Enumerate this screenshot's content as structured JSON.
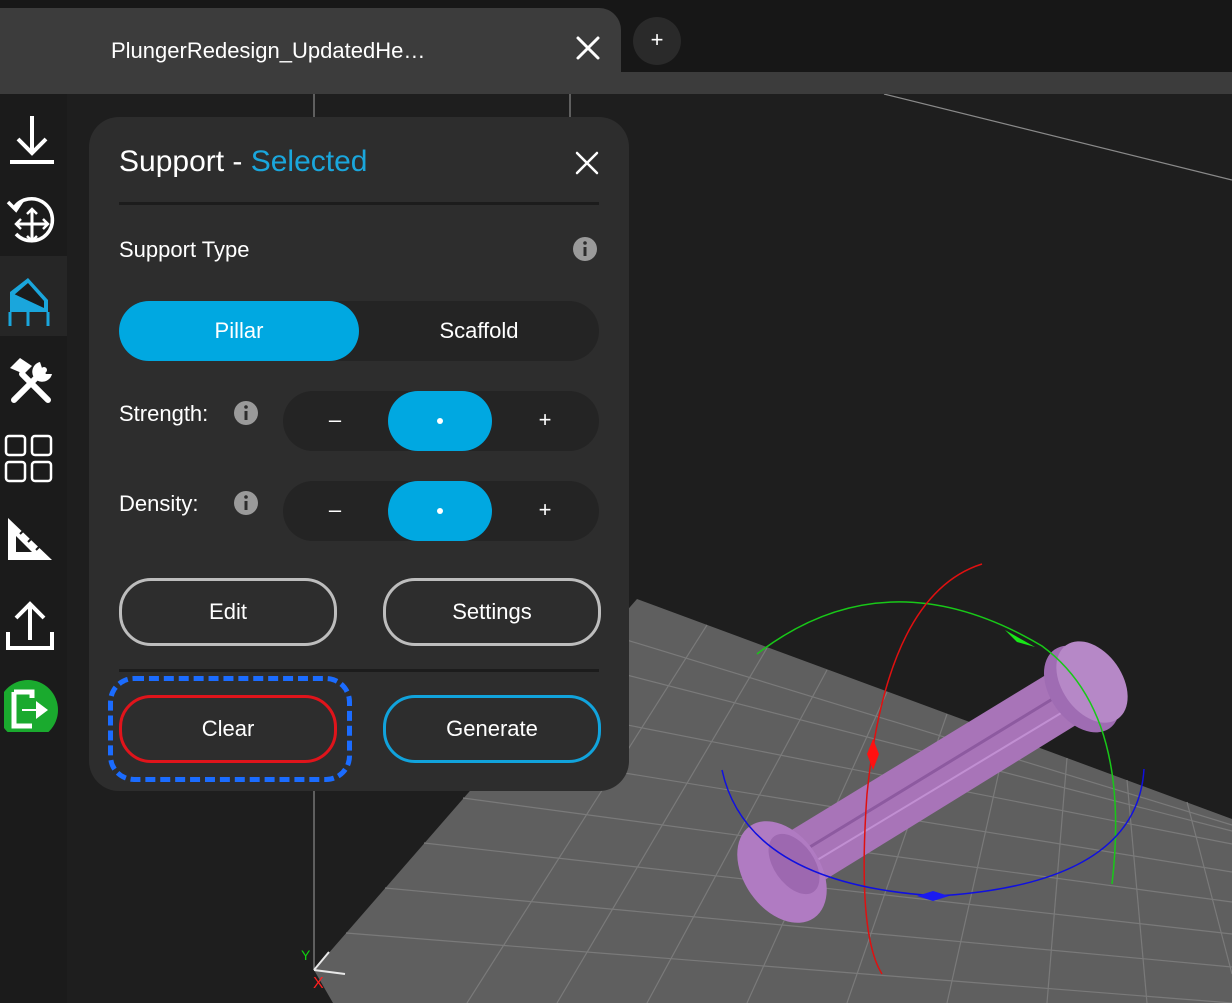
{
  "tab": {
    "title": "PlungerRedesign_UpdatedHe…",
    "new_tab_label": "+"
  },
  "sidebar": {
    "items": [
      {
        "icon": "download-icon"
      },
      {
        "icon": "rotate-move-icon"
      },
      {
        "icon": "support-icon",
        "active": true
      },
      {
        "icon": "tools-icon"
      },
      {
        "icon": "arrange-grid-icon"
      },
      {
        "icon": "measure-ruler-icon"
      },
      {
        "icon": "upload-icon"
      },
      {
        "icon": "exit-icon"
      }
    ]
  },
  "panel": {
    "title": "Support - ",
    "title_state": "Selected",
    "support_type_label": "Support Type",
    "support_type_options": [
      "Pillar",
      "Scaffold"
    ],
    "support_type_selected": "Pillar",
    "strength_label": "Strength:",
    "density_label": "Density:",
    "stepper_minus": "–",
    "stepper_plus": "+",
    "edit_label": "Edit",
    "settings_label": "Settings",
    "clear_label": "Clear",
    "generate_label": "Generate"
  },
  "colors": {
    "accent": "#00a8e1",
    "clear_border": "#e0141b",
    "focus_ring": "#1b6cff",
    "model": "#b07bc2",
    "exit_icon_bg": "#1aaa2e"
  }
}
